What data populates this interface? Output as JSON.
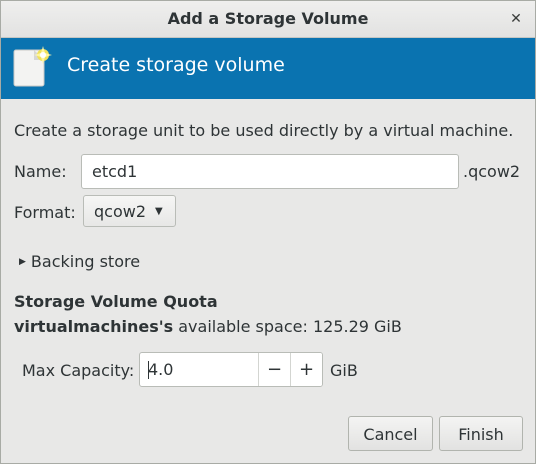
{
  "window": {
    "title": "Add a Storage Volume",
    "close_glyph": "✕"
  },
  "banner": {
    "title": "Create storage volume",
    "icon": "new-volume-icon",
    "color": "#0a73b0"
  },
  "form": {
    "description": "Create a storage unit to be used directly by a virtual machine.",
    "name_label": "Name:",
    "name_value": "etcd1",
    "name_suffix": ".qcow2",
    "format_label": "Format:",
    "format_value": "qcow2",
    "backing_store_label": "Backing store",
    "backing_store_expanded": false
  },
  "quota": {
    "heading": "Storage Volume Quota",
    "pool_name": "virtualmachines's",
    "available_text": "available space: 125.29 GiB",
    "max_capacity_label": "Max Capacity:",
    "max_capacity_value": "4.0",
    "decrement_label": "−",
    "increment_label": "+",
    "unit": "GiB"
  },
  "buttons": {
    "cancel": "Cancel",
    "finish": "Finish"
  }
}
